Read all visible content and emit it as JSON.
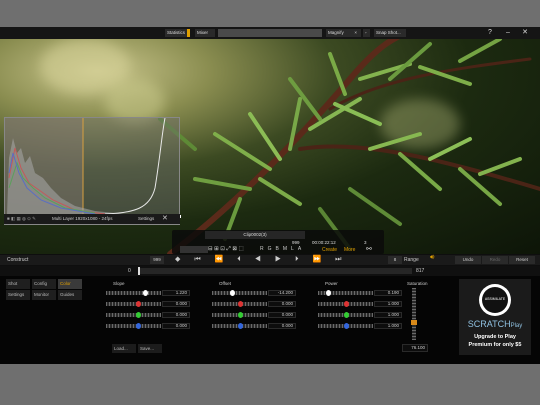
{
  "topbar": {
    "statistics": "Statistics",
    "mixer": "Mixer",
    "magnify": "Magnify",
    "snap_shot": "Snap Shot..."
  },
  "viewer": {
    "histogram_status": "Multi Layer 1920x1080 - 24fps",
    "settings": "Settings",
    "clip_name": "Clip0002(3)",
    "frame": "999",
    "timecode": "00:00:22:12",
    "frames_right": "3",
    "channels": [
      "R",
      "G",
      "B",
      "M",
      "L",
      "A"
    ],
    "create": "Create",
    "more": "More"
  },
  "timeline": {
    "construct": "Construct",
    "frame_left": "999",
    "frame_right": "8",
    "range": "Range",
    "undo": "Undo",
    "redo": "Redo",
    "reset": "Reset",
    "start": "0",
    "end": "817"
  },
  "panel": {
    "nav": [
      "Shot",
      "Config",
      "Color",
      "Settings",
      "Monitor",
      "Guides"
    ],
    "groups": [
      {
        "title": "Slope",
        "values": [
          "1.220",
          "0.000",
          "0.000",
          "0.000"
        ]
      },
      {
        "title": "Offset",
        "values": [
          "-14.200",
          "0.000",
          "0.000",
          "0.000"
        ]
      },
      {
        "title": "Power",
        "values": [
          "0.190",
          "1.000",
          "1.000",
          "1.000"
        ]
      }
    ],
    "saturation_title": "Saturation",
    "saturation_value": "76.100",
    "load": "Load...",
    "save": "Save..."
  },
  "promo": {
    "brand": "ASSIMILATE",
    "product": "SCRATCH",
    "product_suffix": "Play",
    "line1": "Upgrade to Play",
    "line2": "Premium for only $5"
  }
}
